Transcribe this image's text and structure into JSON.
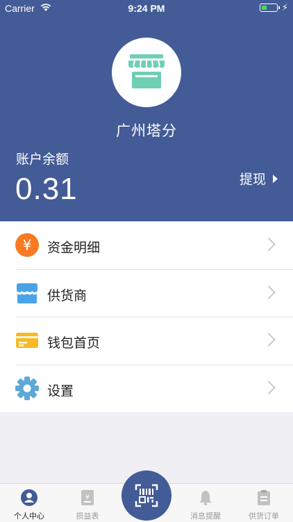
{
  "status_bar": {
    "carrier": "Carrier",
    "time": "9:24 PM",
    "battery_level": 0.25
  },
  "header": {
    "shop_icon": "storefront-icon",
    "shop_name": "广州塔分",
    "balance_label": "账户余额",
    "balance_value": "0.31",
    "withdraw_label": "提现",
    "background_color": "#435b96"
  },
  "menu": {
    "items": [
      {
        "label": "资金明细",
        "icon": "yen-coin-icon",
        "color": "#f97a21"
      },
      {
        "label": "供货商",
        "icon": "supplier-shop-icon",
        "color": "#4aa3e8"
      },
      {
        "label": "钱包首页",
        "icon": "wallet-card-icon",
        "color": "#f8b925"
      },
      {
        "label": "设置",
        "icon": "gear-icon",
        "color": "#5ea8d8"
      }
    ]
  },
  "tabbar": {
    "tabs": [
      {
        "label": "个人中心",
        "icon": "person-icon",
        "active": true
      },
      {
        "label": "损益表",
        "icon": "ledger-icon",
        "active": false
      },
      {
        "label": "消息提醒",
        "icon": "bell-icon",
        "active": false
      },
      {
        "label": "供货订单",
        "icon": "clipboard-icon",
        "active": false
      }
    ],
    "center_icon": "scan-code-icon"
  }
}
